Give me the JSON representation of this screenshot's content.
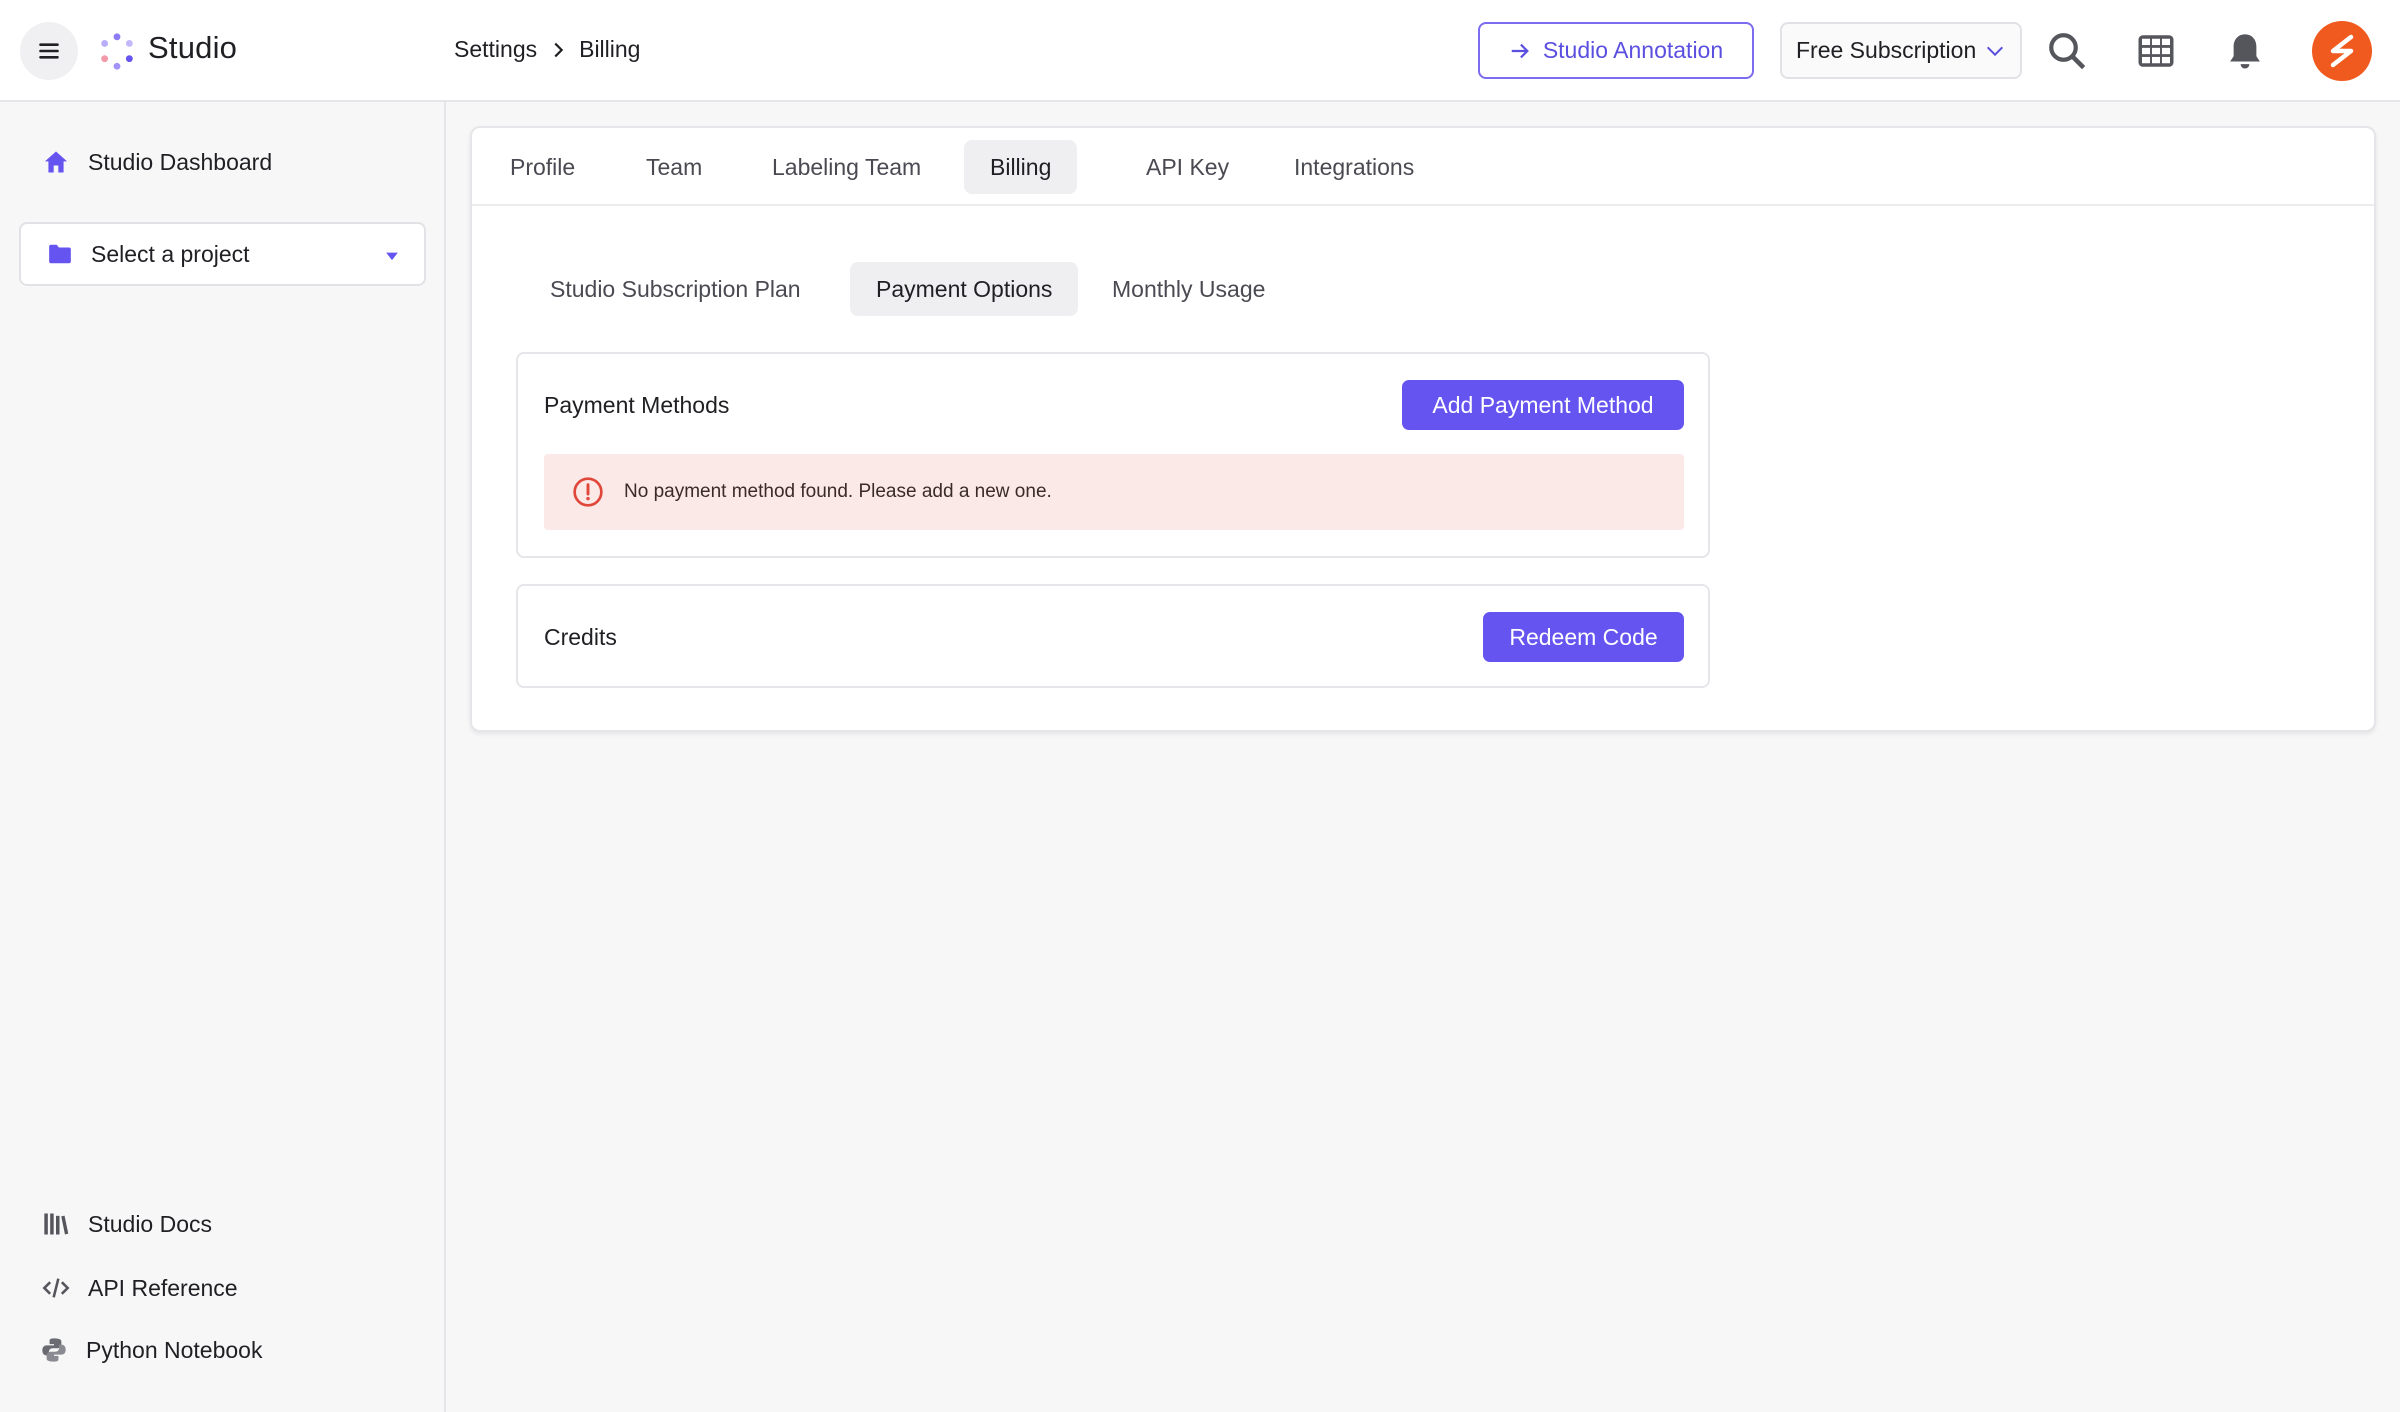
{
  "app": {
    "brand": "Studio"
  },
  "breadcrumb": {
    "items": [
      "Settings",
      "Billing"
    ]
  },
  "header": {
    "annotation_label": "Studio Annotation",
    "subscription_label": "Free Subscription",
    "accent": "#6554f0",
    "avatar_color": "#f15a1e"
  },
  "sidebar": {
    "dashboard_label": "Studio Dashboard",
    "project_placeholder": "Select a project",
    "docs_label": "Studio Docs",
    "api_label": "API Reference",
    "notebook_label": "Python Notebook"
  },
  "tabs": [
    {
      "label": "Profile",
      "active": false
    },
    {
      "label": "Team",
      "active": false
    },
    {
      "label": "Labeling Team",
      "active": false
    },
    {
      "label": "Billing",
      "active": true
    },
    {
      "label": "API Key",
      "active": false
    },
    {
      "label": "Integrations",
      "active": false
    }
  ],
  "subtabs": [
    {
      "label": "Studio Subscription Plan",
      "active": false
    },
    {
      "label": "Payment Options",
      "active": true
    },
    {
      "label": "Monthly Usage",
      "active": false
    }
  ],
  "payment": {
    "title": "Payment Methods",
    "add_label": "Add Payment Method",
    "alert_text": "No payment method found. Please add a new one.",
    "alert_color": "#e0473a"
  },
  "credits": {
    "title": "Credits",
    "redeem_label": "Redeem Code"
  }
}
